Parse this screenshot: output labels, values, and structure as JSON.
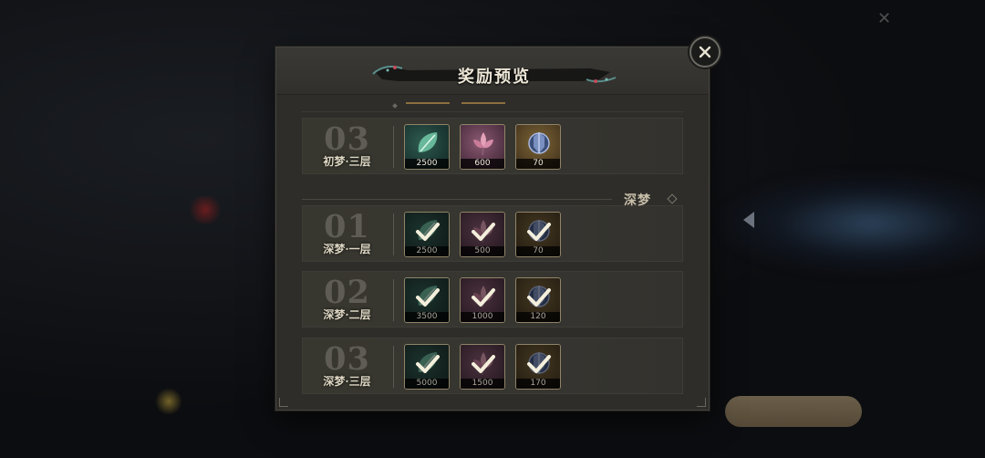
{
  "dialog": {
    "title": "奖励预览"
  },
  "section": {
    "deep_dream_label": "深梦"
  },
  "rows": [
    {
      "num": "03",
      "name": "初梦·三层",
      "claimed": false,
      "items": [
        {
          "icon": "green-leaf-icon",
          "count": "2500"
        },
        {
          "icon": "pink-flower-icon",
          "count": "600"
        },
        {
          "icon": "blue-crystal-icon",
          "count": "70"
        }
      ]
    },
    {
      "num": "01",
      "name": "深梦·一层",
      "claimed": true,
      "items": [
        {
          "icon": "green-leaf-icon",
          "count": "2500"
        },
        {
          "icon": "pink-flower-icon",
          "count": "500"
        },
        {
          "icon": "blue-crystal-icon",
          "count": "70"
        }
      ]
    },
    {
      "num": "02",
      "name": "深梦·二层",
      "claimed": true,
      "items": [
        {
          "icon": "green-leaf-icon",
          "count": "3500"
        },
        {
          "icon": "pink-flower-icon",
          "count": "1000"
        },
        {
          "icon": "blue-crystal-icon",
          "count": "120"
        }
      ]
    },
    {
      "num": "03",
      "name": "深梦·三层",
      "claimed": true,
      "items": [
        {
          "icon": "green-leaf-icon",
          "count": "5000"
        },
        {
          "icon": "pink-flower-icon",
          "count": "1500"
        },
        {
          "icon": "blue-crystal-icon",
          "count": "170"
        }
      ]
    }
  ],
  "colors": {
    "accent_gold": "#8c6f3e",
    "panel": "#2e2d2a",
    "check": "#f4efdc"
  }
}
